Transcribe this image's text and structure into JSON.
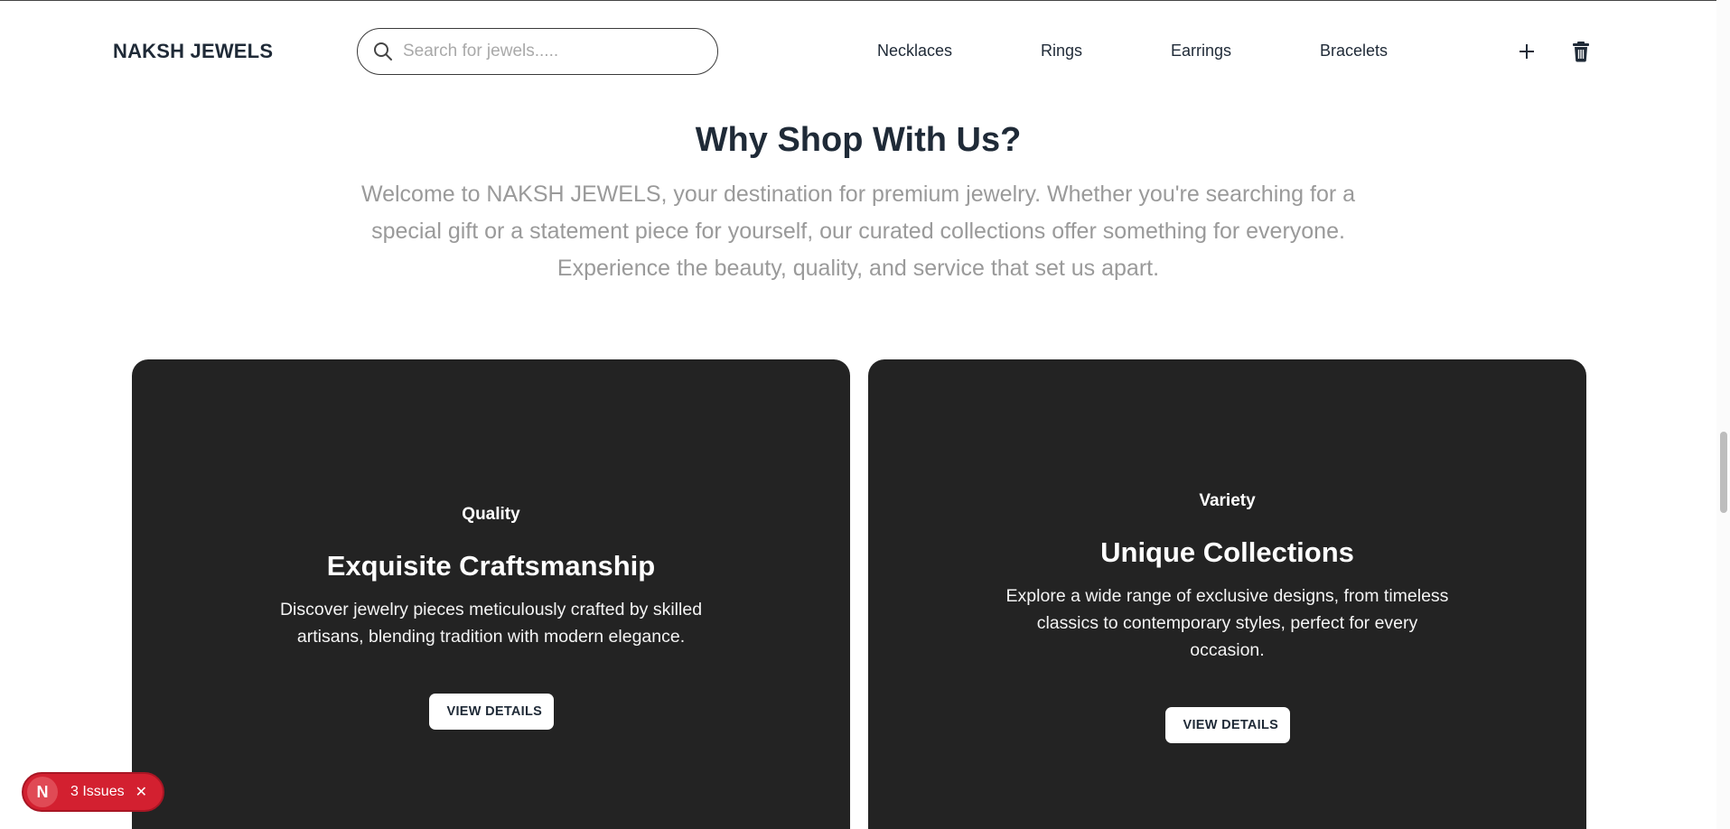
{
  "header": {
    "brand": "NAKSH JEWELS",
    "search": {
      "placeholder": "Search for jewels.....",
      "value": ""
    },
    "nav": [
      "Necklaces",
      "Rings",
      "Earrings",
      "Bracelets"
    ],
    "icons": {
      "search": "search-icon",
      "add": "plus-icon",
      "delete": "trash-icon"
    }
  },
  "hero": {
    "title": "Why Shop With Us?",
    "text": "Welcome to NAKSH JEWELS, your destination for premium jewelry. Whether you're searching for a special gift or a statement piece for yourself, our curated collections offer something for everyone. Experience the beauty, quality, and service that set us apart."
  },
  "cards": [
    {
      "eyebrow": "Quality",
      "title": "Exquisite Craftsmanship",
      "description": "Discover jewelry pieces meticulously crafted by skilled artisans, blending tradition with modern elegance.",
      "button": "VIEW DETAILS"
    },
    {
      "eyebrow": "Variety",
      "title": "Unique Collections",
      "description": "Explore a wide range of exclusive designs, from timeless classics to contemporary styles, perfect for every occasion.",
      "button": "VIEW DETAILS"
    }
  ],
  "issues": {
    "badge": "N",
    "label": "3 Issues",
    "close": "✕"
  },
  "colors": {
    "text_dark": "#1f2a37",
    "muted": "#9a9a9a",
    "card_bg": "#232323",
    "issues_red": "#d32030"
  }
}
